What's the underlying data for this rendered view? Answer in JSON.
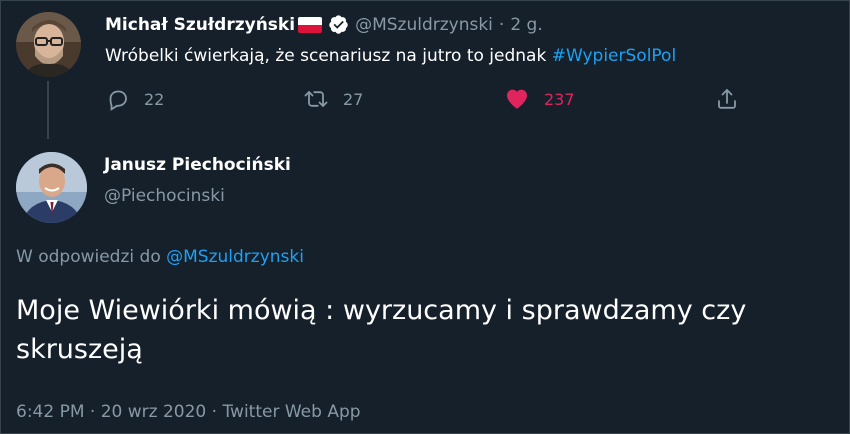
{
  "colors": {
    "background": "#15202b",
    "primary_text": "#ffffff",
    "secondary_text": "#8899a6",
    "link": "#1da1f2",
    "like": "#e0245e",
    "divider": "#38444d"
  },
  "parent_tweet": {
    "author_name": "Michał Szułdrzyński",
    "flag_icon": "poland-flag-icon",
    "verified_icon": "verified-badge-icon",
    "handle": "@MSzuldrzynski",
    "separator": "·",
    "time": "2 g.",
    "text": "Wróbelki ćwierkają, że scenariusz na jutro to jednak ",
    "hashtag": "#WypierSolPol",
    "actions": {
      "reply": {
        "icon": "reply-icon",
        "count": "22"
      },
      "retweet": {
        "icon": "retweet-icon",
        "count": "27"
      },
      "like": {
        "icon": "heart-filled-icon",
        "count": "237"
      },
      "share": {
        "icon": "share-icon"
      }
    }
  },
  "main_tweet": {
    "author_name": "Janusz Piechociński",
    "handle": "@Piechocinski",
    "reply_prefix": "W odpowiedzi do ",
    "reply_mention": "@MSzuldrzynski",
    "text": "Moje Wiewiórki mówią : wyrzucamy i sprawdzamy czy skruszeją",
    "time": "6:42 PM",
    "separator1": "·",
    "date": "20 wrz 2020",
    "separator2": "·",
    "source": "Twitter Web App"
  }
}
